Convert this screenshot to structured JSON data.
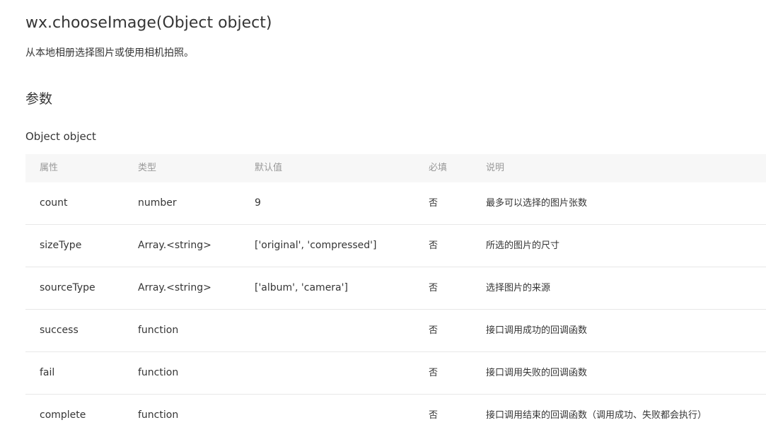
{
  "api": {
    "title": "wx.chooseImage(Object object)",
    "description": "从本地相册选择图片或使用相机拍照。"
  },
  "params_section": {
    "heading": "参数",
    "object_label": "Object object"
  },
  "table": {
    "headers": {
      "attr": "属性",
      "type": "类型",
      "default": "默认值",
      "required": "必填",
      "desc": "说明"
    },
    "rows": [
      {
        "attr": "count",
        "type": "number",
        "default": "9",
        "required": "否",
        "desc": "最多可以选择的图片张数"
      },
      {
        "attr": "sizeType",
        "type": "Array.<string>",
        "default": "['original', 'compressed']",
        "required": "否",
        "desc": "所选的图片的尺寸"
      },
      {
        "attr": "sourceType",
        "type": "Array.<string>",
        "default": "['album', 'camera']",
        "required": "否",
        "desc": "选择图片的来源"
      },
      {
        "attr": "success",
        "type": "function",
        "default": "",
        "required": "否",
        "desc": "接口调用成功的回调函数"
      },
      {
        "attr": "fail",
        "type": "function",
        "default": "",
        "required": "否",
        "desc": "接口调用失败的回调函数"
      },
      {
        "attr": "complete",
        "type": "function",
        "default": "",
        "required": "否",
        "desc": "接口调用结束的回调函数（调用成功、失败都会执行）"
      }
    ]
  }
}
